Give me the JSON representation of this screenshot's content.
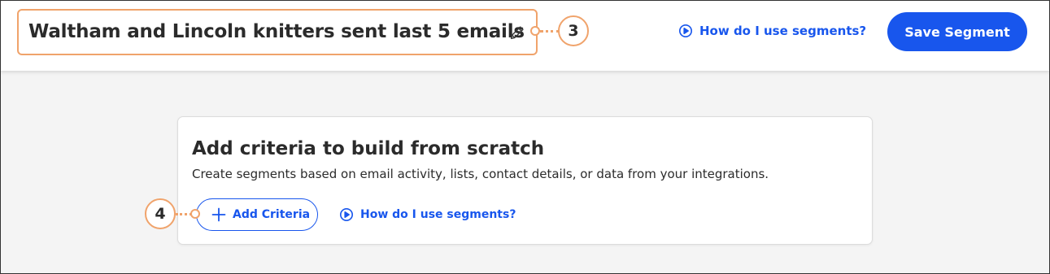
{
  "header": {
    "segment_title": "Waltham and Lincoln knitters sent last 5 emails",
    "help_link": "How do I use segments?",
    "save_button": "Save Segment"
  },
  "callouts": {
    "title_callout": "3",
    "add_callout": "4"
  },
  "card": {
    "title": "Add criteria to build from scratch",
    "description": "Create segments based on email activity, lists, contact details, or data from your integrations.",
    "add_button": "Add Criteria",
    "help_link": "How do I use segments?"
  },
  "colors": {
    "accent": "#1856ed",
    "callout": "#f0a36b",
    "text": "#2b2b2b",
    "background": "#f4f4f4"
  },
  "icons": [
    "pencil-icon",
    "play-circle-icon",
    "plus-icon"
  ]
}
